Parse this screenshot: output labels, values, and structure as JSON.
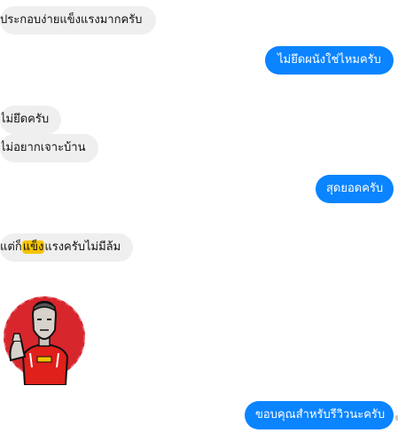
{
  "conversation": {
    "messages": [
      {
        "from": "them",
        "text": "ประกอบง่ายแข็งแรงมากครับ"
      },
      {
        "from": "me",
        "text": "ไม่ยึดผนังใช่ไหมครับ"
      },
      {
        "from": "them",
        "text": "ไม่ยึดครับ"
      },
      {
        "from": "them",
        "text": "ไม่อยากเจาะบ้าน"
      },
      {
        "from": "me",
        "text": "สุดยอดครับ"
      },
      {
        "from": "them",
        "text_before": "แต่ก็",
        "highlight": "แข็ง",
        "text_after": "แรงครับไม่มีล้ม"
      },
      {
        "from": "them",
        "sticker": "football-player-sticker"
      },
      {
        "from": "me",
        "text": "ขอบคุณสำหรับรีวิวนะครับ"
      }
    ]
  },
  "colors": {
    "sent_bubble": "#0a84ff",
    "received_bubble": "#efefef",
    "highlight": "#f5c400"
  }
}
